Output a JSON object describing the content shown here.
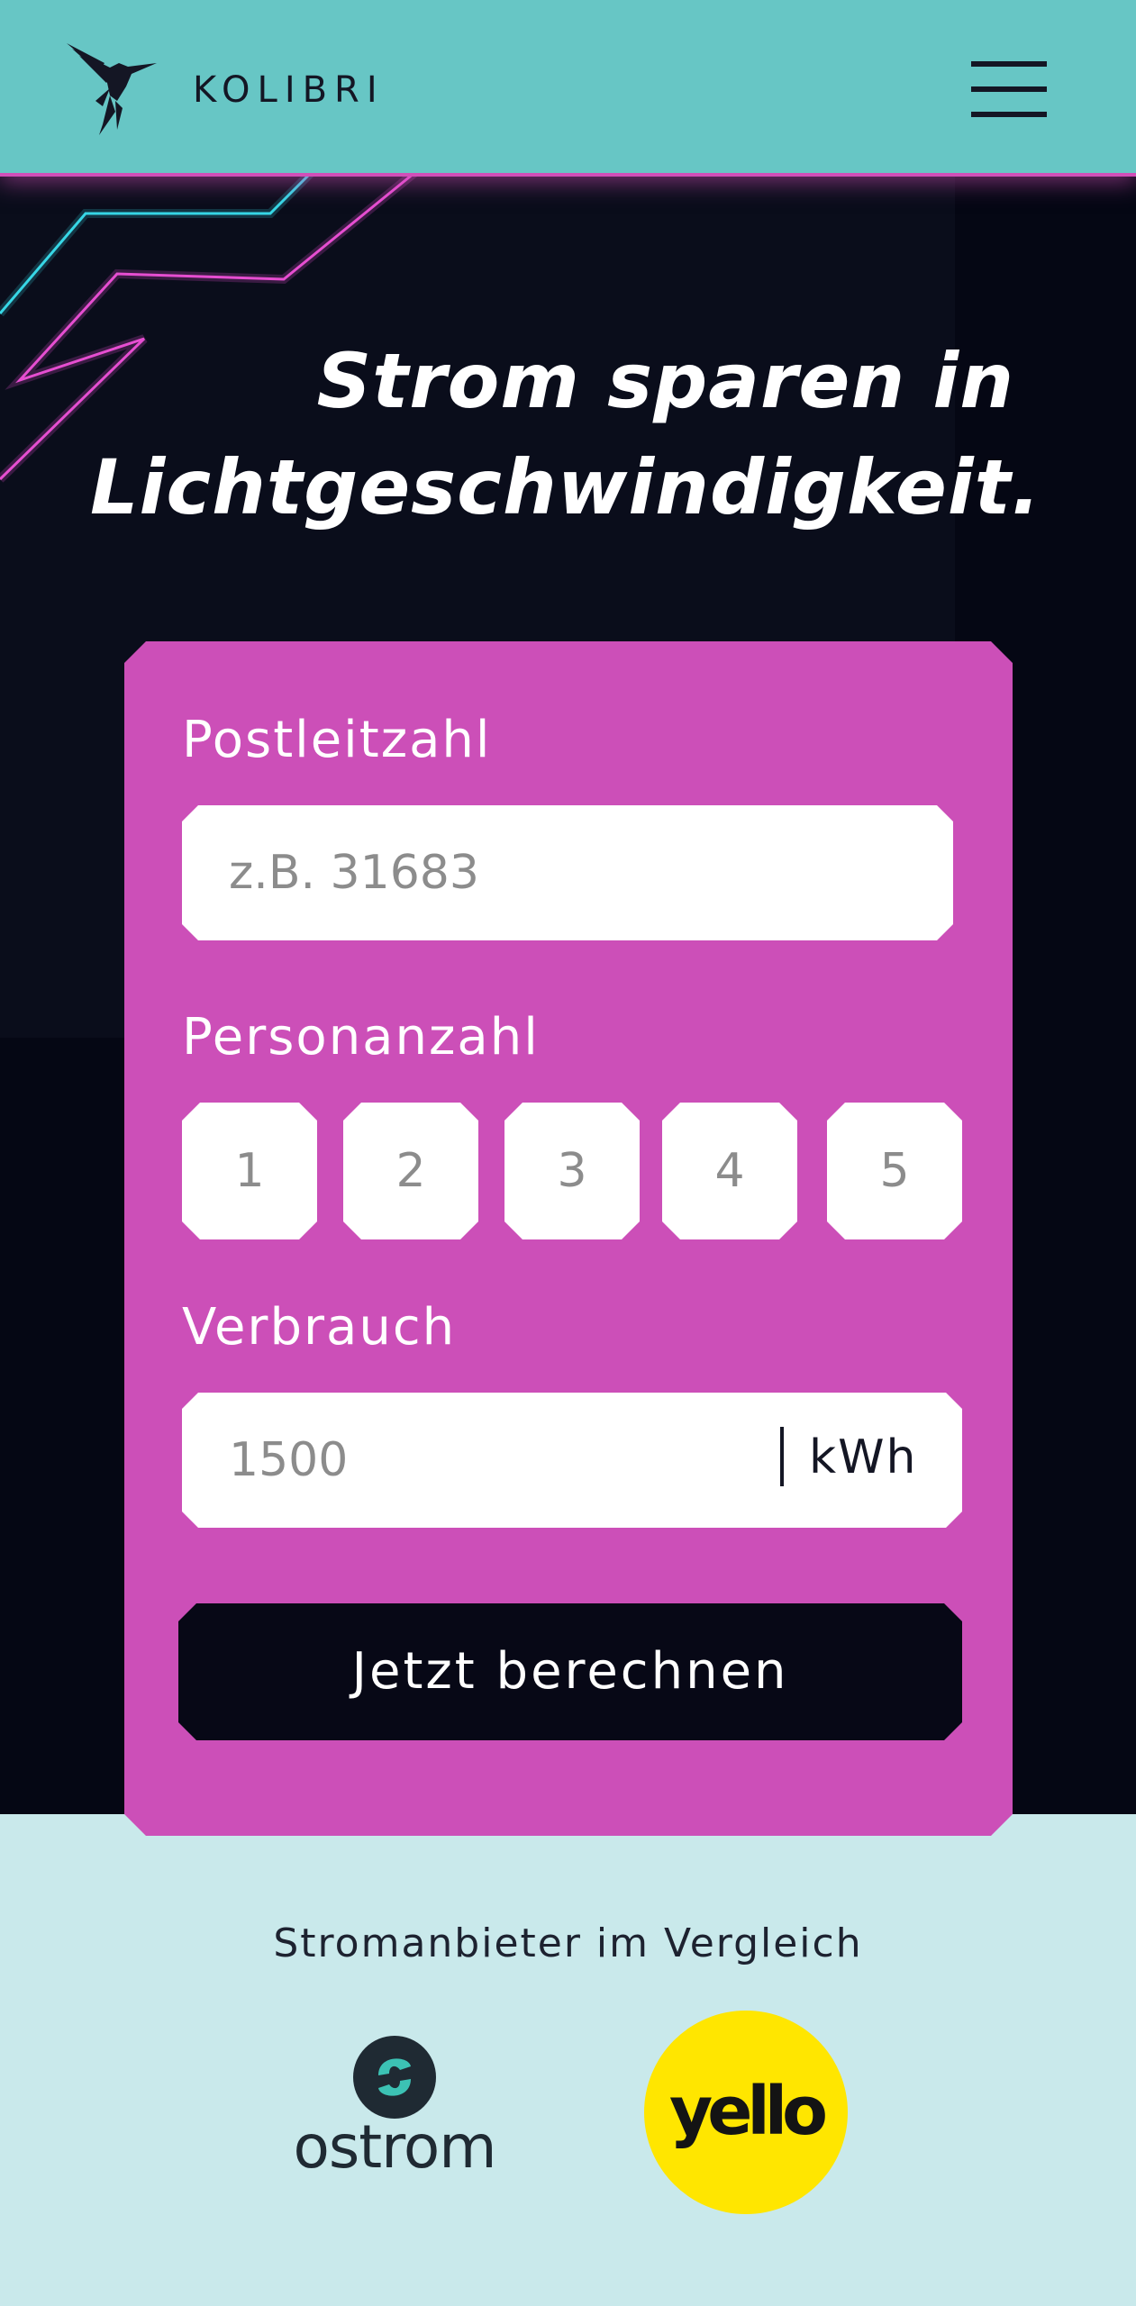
{
  "header": {
    "brand": "KOLIBRI",
    "logo_icon": "hummingbird-icon",
    "menu_icon": "hamburger-menu-icon"
  },
  "hero": {
    "headline_line1": "Strom sparen in",
    "headline_line2": "Lichtgeschwindigkeit."
  },
  "form": {
    "postcode": {
      "label": "Postleitzahl",
      "placeholder": "z.B. 31683",
      "value": ""
    },
    "persons": {
      "label": "Personanzahl",
      "options": [
        "1",
        "2",
        "3",
        "4",
        "5"
      ],
      "selected": null
    },
    "consumption": {
      "label": "Verbrauch",
      "placeholder": "1500",
      "value": "",
      "unit": "kWh"
    },
    "submit_label": "Jetzt berechnen"
  },
  "providers": {
    "title": "Stromanbieter im Vergleich",
    "items": [
      {
        "name": "ostrom",
        "icon": "ostrom-logo",
        "color": "#1f2a33",
        "accent": "#3cc2b4"
      },
      {
        "name": "yello",
        "icon": "yello-logo",
        "color": "#141414",
        "accent": "#ffe600"
      }
    ]
  },
  "colors": {
    "header_bg": "#67c6c5",
    "hero_bg": "#050714",
    "card_bg": "#cc4fb8",
    "neon_pink": "#e64fd1",
    "neon_cyan": "#38d7e6",
    "button_bg": "#070816",
    "footer_bg": "#c9e9eb"
  }
}
